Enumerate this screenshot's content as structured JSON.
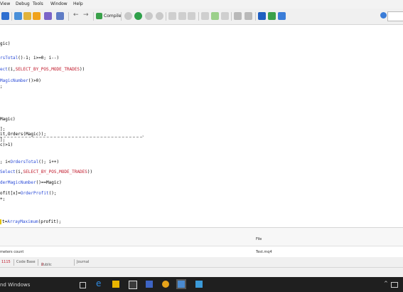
{
  "menubar": {
    "items": [
      "View",
      "Debug",
      "Tools",
      "Window",
      "Help"
    ]
  },
  "toolbar": {
    "compile_label": "Compile",
    "buttons": [
      "save-icon",
      "folder-icon",
      "plugin-icon",
      "align-left-icon",
      "align-right-icon",
      "back-arrow-icon",
      "forward-arrow-icon",
      "compile-icon",
      "stop-icon",
      "play-icon",
      "pause-icon",
      "record-icon",
      "bookmark-icon",
      "bookmark-prev-icon",
      "bookmark-next-icon",
      "step-into-icon",
      "step-over-icon",
      "step-out-icon",
      "chart-icon",
      "graph-icon",
      "pen-icon",
      "globe-icon",
      "window-icon"
    ],
    "accent": "#3b7dd8"
  },
  "editor": {
    "lines": [
      {
        "t": "gic)"
      },
      {
        "t": "rsTotal()-1; i>=0; i--)",
        "hl": "rsTotal"
      },
      {
        "t": "ect(i,SELECT_BY_POS,MODE_TRADES))",
        "hl": "ect"
      },
      {
        "t": "MagicNumber()>0)",
        "hl": "MagicNumber"
      },
      {
        "t": ";"
      },
      {
        "t": "Magic)"
      },
      {
        "t": "];"
      },
      {
        "t": "it,Orders(Magic));"
      },
      {
        "t": "];"
      },
      {
        "t": "c)>1)"
      },
      {
        "t": "; i<OrdersTotal(); i++)",
        "hl": "OrdersTotal"
      },
      {
        "t": "Select(i,SELECT_BY_POS,MODE_TRADES))",
        "hl": "Select"
      },
      {
        "t": "derMagicNumber()==Magic)",
        "hl": "derMagicNumber"
      },
      {
        "t": "ofit[x]=OrderProfit();",
        "hl": "OrderProfit"
      },
      {
        "t": "+;"
      },
      {
        "t": "t=ArrayMaximum(profit);",
        "hl": "ArrayMaximum"
      }
    ]
  },
  "panel": {
    "file_header": "File",
    "left_label": "meters count",
    "right_value": "Test.mq4"
  },
  "tabs": {
    "items": [
      "1115",
      "Code Base",
      "Public Projects",
      "Journal"
    ],
    "badge_number": "1115",
    "public_projects_badge": "2"
  },
  "taskbar": {
    "activation_text": "nd Windows",
    "icons": [
      "task-view-icon",
      "edge-icon",
      "explorer-icon",
      "store-icon",
      "teams-icon",
      "mt4-icon",
      "metaeditor-icon",
      "notes-icon"
    ]
  }
}
